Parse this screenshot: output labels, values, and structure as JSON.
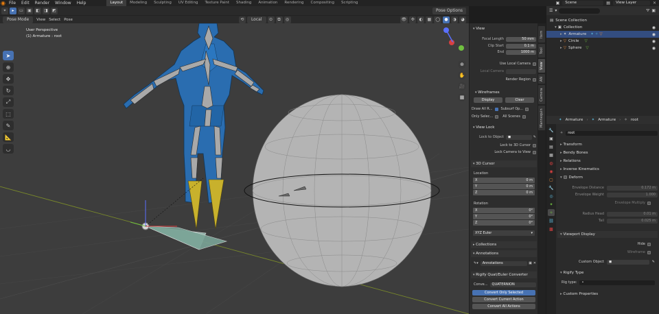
{
  "app": {
    "menu": [
      "File",
      "Edit",
      "Render",
      "Window",
      "Help"
    ],
    "workspaces": [
      "Layout",
      "Modeling",
      "Sculpting",
      "UV Editing",
      "Texture Paint",
      "Shading",
      "Animation",
      "Rendering",
      "Compositing",
      "Scripting"
    ],
    "active_workspace": "Layout",
    "scene": "Scene",
    "view_layer": "View Layer"
  },
  "viewport_header": {
    "mode": "Pose Mode",
    "menus": [
      "View",
      "Select",
      "Pose"
    ],
    "orientation": "Local",
    "pose_options": "Pose Options"
  },
  "viewport": {
    "view_name": "User Perspective",
    "active_object": "(1) Armature : root"
  },
  "npanel": {
    "tabs": [
      "Item",
      "Tool",
      "View",
      "AN",
      "Camera",
      "Mannequin"
    ],
    "active_tab": "View",
    "view": {
      "title": "View",
      "focal_length_label": "Focal Length",
      "focal_length": "50 mm",
      "clip_start_label": "Clip Start",
      "clip_start": "0.1 m",
      "clip_end_label": "End",
      "clip_end": "1000 m",
      "use_local_camera": "Use Local Camera",
      "local_camera": "Local Camera",
      "render_region": "Render Region"
    },
    "wireframes": {
      "title": "Wireframes",
      "display": "Display",
      "clear": "Clear",
      "draw_all": "Draw All R...",
      "subsurf": "Subsurf Op...",
      "only_selected": "Only Selec...",
      "all_scenes": "All Scenes"
    },
    "view_lock": {
      "title": "View Lock",
      "lock_to_object": "Lock to Object",
      "lock_3d_cursor": "Lock to 3D Cursor",
      "lock_camera": "Lock Camera to View"
    },
    "cursor": {
      "title": "3D Cursor",
      "location_label": "Location",
      "location": [
        {
          "axis": "X",
          "value": "0 m"
        },
        {
          "axis": "Y",
          "value": "0 m"
        },
        {
          "axis": "Z",
          "value": "0 m"
        }
      ],
      "rotation_label": "Rotation",
      "rotation": [
        {
          "axis": "X",
          "value": "0°"
        },
        {
          "axis": "Y",
          "value": "0°"
        },
        {
          "axis": "Z",
          "value": "0°"
        }
      ],
      "rotation_mode": "XYZ Euler"
    },
    "collections": "Collections",
    "annotations": {
      "title": "Annotations",
      "field": "Annotations"
    },
    "rigify": {
      "title": "Rigify Quat/Euler Converter",
      "mode_label": "Conve...",
      "mode_value": "QUATERNION",
      "convert_selected": "Convert Only Selected",
      "convert_current": "Convert Current Action",
      "convert_all": "Convert All Actions"
    }
  },
  "outliner": {
    "search_placeholder": "",
    "rows": [
      {
        "label": "Scene Collection",
        "indent": 0,
        "selected": false
      },
      {
        "label": "Collection",
        "indent": 1,
        "selected": false
      },
      {
        "label": "Armature",
        "indent": 2,
        "selected": true
      },
      {
        "label": "Circle",
        "indent": 2,
        "selected": false
      },
      {
        "label": "Sphere",
        "indent": 2,
        "selected": false
      }
    ]
  },
  "properties": {
    "breadcrumb": [
      "Armature",
      "Armature",
      "root"
    ],
    "bone_name": "root",
    "sections": {
      "transform": "Transform",
      "bendy_bones": "Bendy Bones",
      "relations": "Relations",
      "inverse_kinematics": "Inverse Kinematics",
      "deform": "Deform",
      "viewport_display": "Viewport Display",
      "rigify_type": "Rigify Type",
      "custom_properties": "Custom Properties"
    },
    "deform": {
      "envelope_distance_label": "Envelope Distance",
      "envelope_distance": "0.172 m",
      "envelope_weight_label": "Envelope Weight",
      "envelope_weight": "1.000",
      "envelope_multiply": "Envelope Multiply",
      "radius_head_label": "Radius Head",
      "radius_head": "0.01 m",
      "tail_label": "Tail",
      "tail": "0.025 m"
    },
    "viewport_display": {
      "hide": "Hide",
      "wireframe": "Wireframe",
      "custom_object": "Custom Object"
    },
    "rig_type_label": "Rig type:"
  },
  "colors": {
    "accent": "#4772b3",
    "mesh_blue": "#2a6db0",
    "bone_grey": "#a9a9a9",
    "bone_yellow": "#c8b12c",
    "sphere": "#b4b4b4"
  }
}
